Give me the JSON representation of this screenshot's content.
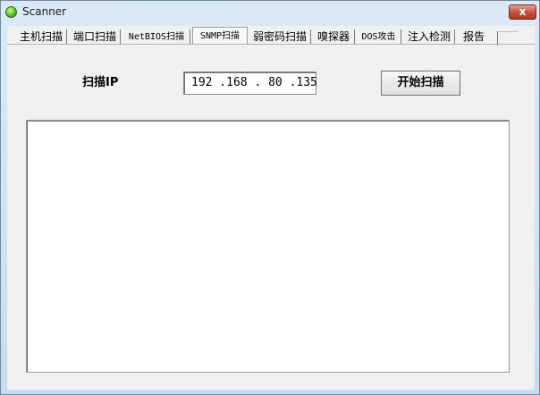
{
  "window": {
    "title": "Scanner",
    "close_label": "x"
  },
  "tabs": [
    {
      "label": "主机扫描"
    },
    {
      "label": "端口扫描"
    },
    {
      "label": "NetBIOS扫描"
    },
    {
      "label": "SNMP扫描"
    },
    {
      "label": "弱密码扫描"
    },
    {
      "label": "嗅探器"
    },
    {
      "label": "DOS攻击"
    },
    {
      "label": "注入检测"
    },
    {
      "label": "报告"
    }
  ],
  "active_tab": 3,
  "scan": {
    "label": "扫描IP",
    "ip_value": "192 .168 . 80 .135",
    "start_button": "开始扫描"
  },
  "output": {
    "text": ""
  }
}
